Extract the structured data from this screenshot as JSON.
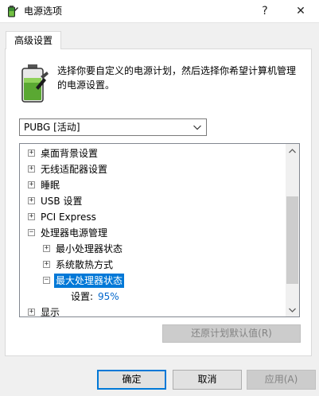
{
  "window": {
    "title": "电源选项",
    "help_label": "?",
    "close_label": "✕"
  },
  "tab": {
    "label": "高级设置"
  },
  "description": "选择你要自定义的电源计划，然后选择你希望计算机管理的电源设置。",
  "plan_select": {
    "value": "PUBG [活动]"
  },
  "tree": {
    "items": [
      {
        "label": "桌面背景设置",
        "expander": "+"
      },
      {
        "label": "无线适配器设置",
        "expander": "+"
      },
      {
        "label": "睡眠",
        "expander": "+"
      },
      {
        "label": "USB 设置",
        "expander": "+"
      },
      {
        "label": "PCI Express",
        "expander": "+"
      },
      {
        "label": "处理器电源管理",
        "expander": "−"
      },
      {
        "label": "最小处理器状态",
        "expander": "+"
      },
      {
        "label": "系统散热方式",
        "expander": "+"
      },
      {
        "label": "最大处理器状态",
        "expander": "−"
      },
      {
        "label": "显示",
        "expander": "+"
      }
    ],
    "setting_label": "设置:",
    "setting_value": "95%"
  },
  "restore_defaults_label": "还原计划默认值(R)",
  "buttons": {
    "ok": "确定",
    "cancel": "取消",
    "apply": "应用(A)"
  },
  "colors": {
    "selection": "#0078d7",
    "value_link": "#0066cc",
    "disabled_text": "#838383"
  },
  "icons": {
    "app": "battery-power-icon",
    "plan_dropdown": "chevron-down-icon",
    "scroll_up": "scroll-up-arrow-icon",
    "scroll_down": "scroll-down-arrow-icon"
  }
}
